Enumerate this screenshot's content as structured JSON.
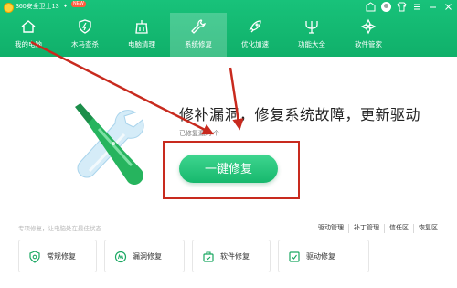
{
  "app": {
    "title": "360安全卫士13",
    "badge": "NEW",
    "star": "♦"
  },
  "nav": {
    "items": [
      {
        "label": "我的电脑",
        "icon": "home-icon"
      },
      {
        "label": "木马查杀",
        "icon": "shield-icon"
      },
      {
        "label": "电脑清理",
        "icon": "broom-icon"
      },
      {
        "label": "系统修复",
        "icon": "wrench-icon",
        "active": true
      },
      {
        "label": "优化加速",
        "icon": "rocket-icon"
      },
      {
        "label": "功能大全",
        "icon": "trident-icon"
      },
      {
        "label": "软件管家",
        "icon": "apps-icon"
      }
    ]
  },
  "main": {
    "headline": "修补漏洞，修复系统故障，更新驱动",
    "subline": "已修复漏洞    个",
    "fix_button": "一键修复"
  },
  "footer": {
    "tip": "专项修复，让电脑处在最佳状态",
    "links": [
      "驱动管理",
      "补丁管理",
      "信任区",
      "恢复区"
    ]
  },
  "cards": [
    {
      "label": "常规修复",
      "icon": "gear-shield-icon"
    },
    {
      "label": "漏洞修复",
      "icon": "vulnerability-icon"
    },
    {
      "label": "软件修复",
      "icon": "software-icon"
    },
    {
      "label": "驱动修复",
      "icon": "driver-icon"
    }
  ],
  "colors": {
    "brand": "#10b06a",
    "annotation": "#c82a1e"
  }
}
